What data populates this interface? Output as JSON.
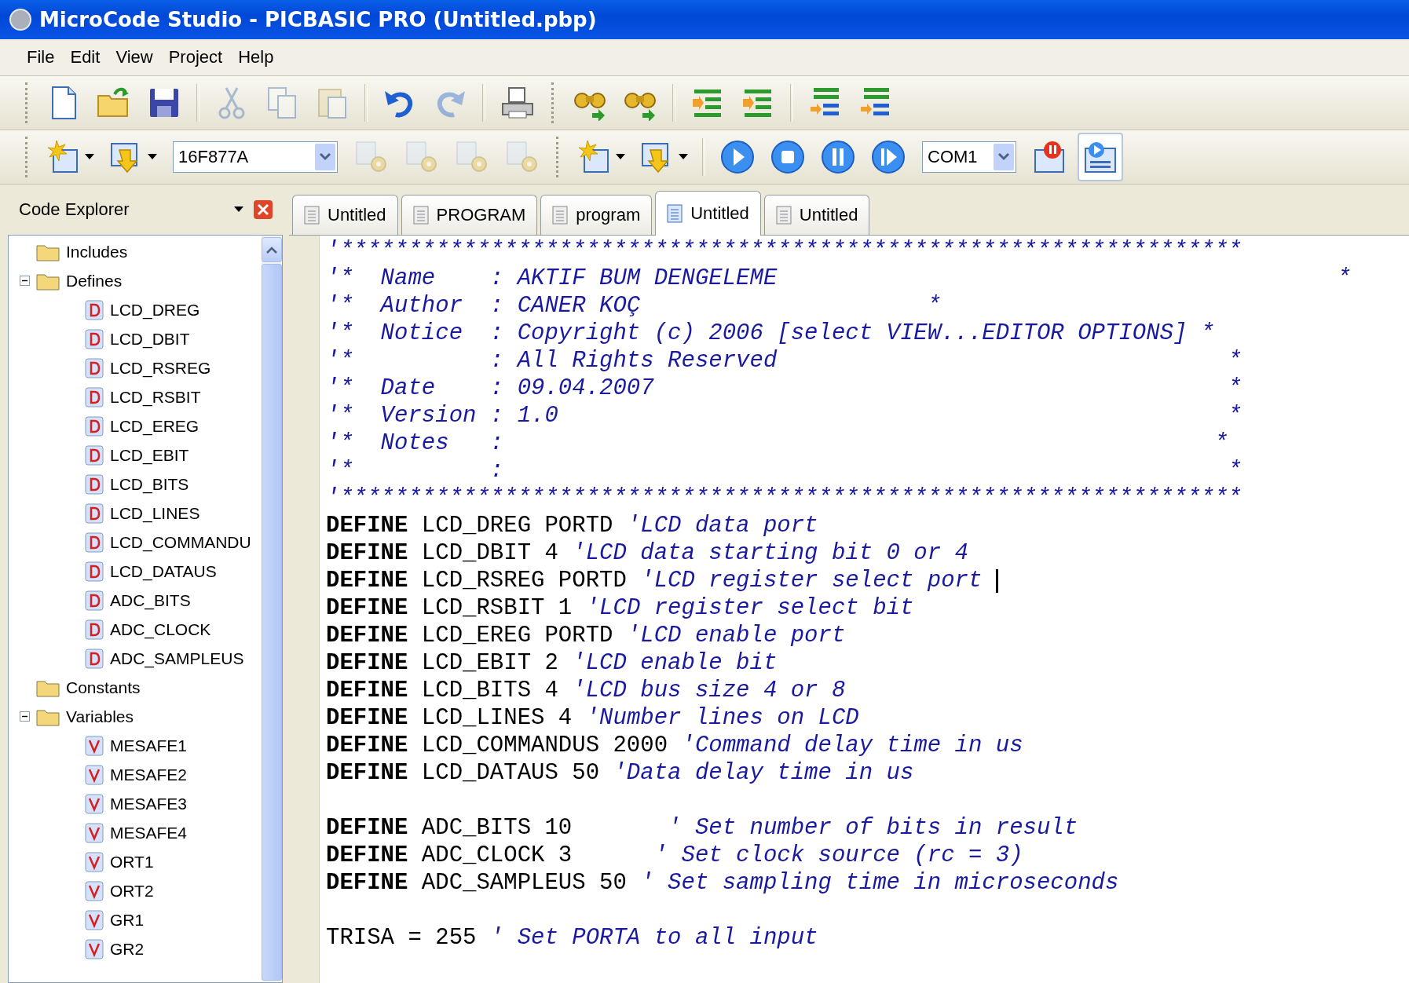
{
  "window": {
    "title": "MicroCode Studio - PICBASIC PRO (Untitled.pbp)"
  },
  "menu": [
    "File",
    "Edit",
    "View",
    "Project",
    "Help"
  ],
  "toolbar_main": [
    {
      "kind": "new",
      "disabled": false
    },
    {
      "kind": "open",
      "disabled": false
    },
    {
      "kind": "save",
      "disabled": false
    },
    {
      "kind": "separator"
    },
    {
      "kind": "cut",
      "disabled": true
    },
    {
      "kind": "copy",
      "disabled": true
    },
    {
      "kind": "paste",
      "disabled": true
    },
    {
      "kind": "separator"
    },
    {
      "kind": "undo",
      "disabled": false
    },
    {
      "kind": "redo",
      "disabled": true
    },
    {
      "kind": "separator"
    },
    {
      "kind": "print",
      "disabled": false
    },
    {
      "kind": "grip"
    },
    {
      "kind": "find",
      "disabled": false
    },
    {
      "kind": "replace",
      "disabled": false
    },
    {
      "kind": "separator"
    },
    {
      "kind": "indent",
      "disabled": false
    },
    {
      "kind": "outdent",
      "disabled": false
    },
    {
      "kind": "separator"
    },
    {
      "kind": "comment",
      "disabled": false
    },
    {
      "kind": "uncomment",
      "disabled": false
    }
  ],
  "toolbar_build": [
    {
      "kind": "new-project",
      "dropdown": true,
      "disabled": false
    },
    {
      "kind": "open-project",
      "dropdown": true,
      "disabled": false
    },
    {
      "kind": "combo",
      "value": "16F877A"
    },
    {
      "kind": "code-check",
      "disabled": true
    },
    {
      "kind": "compile",
      "disabled": true
    },
    {
      "kind": "stop-compile",
      "disabled": true
    },
    {
      "kind": "info",
      "disabled": true
    },
    {
      "kind": "grip"
    },
    {
      "kind": "new-window",
      "dropdown": true,
      "disabled": false
    },
    {
      "kind": "open-window",
      "dropdown": true,
      "disabled": false
    },
    {
      "kind": "separator"
    },
    {
      "kind": "run",
      "disabled": false
    },
    {
      "kind": "stop",
      "disabled": false
    },
    {
      "kind": "pause",
      "disabled": false
    },
    {
      "kind": "step",
      "disabled": false
    },
    {
      "kind": "combo",
      "value": "COM1"
    },
    {
      "kind": "monitor-pause",
      "disabled": false
    },
    {
      "kind": "loader",
      "disabled": false,
      "selected": true
    }
  ],
  "explorer": {
    "title": "Code Explorer",
    "tree": [
      {
        "label": "Includes",
        "kind": "folder"
      },
      {
        "label": "Defines",
        "kind": "folder",
        "expanded": true,
        "children": [
          {
            "label": "LCD_DREG",
            "kind": "define"
          },
          {
            "label": "LCD_DBIT",
            "kind": "define"
          },
          {
            "label": "LCD_RSREG",
            "kind": "define"
          },
          {
            "label": "LCD_RSBIT",
            "kind": "define"
          },
          {
            "label": "LCD_EREG",
            "kind": "define"
          },
          {
            "label": "LCD_EBIT",
            "kind": "define"
          },
          {
            "label": "LCD_BITS",
            "kind": "define"
          },
          {
            "label": "LCD_LINES",
            "kind": "define"
          },
          {
            "label": "LCD_COMMANDU",
            "kind": "define"
          },
          {
            "label": "LCD_DATAUS",
            "kind": "define"
          },
          {
            "label": "ADC_BITS",
            "kind": "define"
          },
          {
            "label": "ADC_CLOCK",
            "kind": "define"
          },
          {
            "label": "ADC_SAMPLEUS",
            "kind": "define"
          }
        ]
      },
      {
        "label": "Constants",
        "kind": "folder"
      },
      {
        "label": "Variables",
        "kind": "folder",
        "expanded": true,
        "children": [
          {
            "label": "MESAFE1",
            "kind": "variable"
          },
          {
            "label": "MESAFE2",
            "kind": "variable"
          },
          {
            "label": "MESAFE3",
            "kind": "variable"
          },
          {
            "label": "MESAFE4",
            "kind": "variable"
          },
          {
            "label": "ORT1",
            "kind": "variable"
          },
          {
            "label": "ORT2",
            "kind": "variable"
          },
          {
            "label": "GR1",
            "kind": "variable"
          },
          {
            "label": "GR2",
            "kind": "variable"
          }
        ]
      }
    ]
  },
  "tabs": [
    {
      "label": "Untitled",
      "selected": false
    },
    {
      "label": "PROGRAM",
      "selected": false
    },
    {
      "label": "program",
      "selected": false
    },
    {
      "label": "Untitled",
      "selected": true
    },
    {
      "label": "Untitled",
      "selected": false
    }
  ],
  "editor": {
    "blocks": [
      {
        "lines": [
          {
            "segments": [
              {
                "kind": "comment",
                "text": "'******************************************************************"
              }
            ]
          },
          {
            "segments": [
              {
                "kind": "comment",
                "text": "'*  Name    : AKTIF BUM DENGELEME                                         *"
              }
            ]
          },
          {
            "segments": [
              {
                "kind": "comment",
                "text": "'*  Author  : CANER KOÇ                     *"
              }
            ]
          },
          {
            "segments": [
              {
                "kind": "comment",
                "text": "'*  Notice  : Copyright (c) 2006 [select VIEW...EDITOR OPTIONS] *"
              }
            ]
          },
          {
            "segments": [
              {
                "kind": "comment",
                "text": "'*          : All Rights Reserved                                 *"
              }
            ]
          },
          {
            "segments": [
              {
                "kind": "comment",
                "text": "'*  Date    : 09.04.2007                                          *"
              }
            ]
          },
          {
            "segments": [
              {
                "kind": "comment",
                "text": "'*  Version : 1.0                                                 *"
              }
            ]
          },
          {
            "segments": [
              {
                "kind": "comment",
                "text": "'*  Notes   :                                                    *"
              }
            ]
          },
          {
            "segments": [
              {
                "kind": "comment",
                "text": "'*          :                                                     *"
              }
            ]
          },
          {
            "segments": [
              {
                "kind": "comment",
                "text": "'******************************************************************"
              }
            ]
          },
          {
            "segments": [
              {
                "kind": "keyword",
                "text": "DEFINE"
              },
              {
                "kind": "plain",
                "text": " LCD_DREG PORTD "
              },
              {
                "kind": "comment",
                "text": "'LCD data port"
              }
            ]
          },
          {
            "segments": [
              {
                "kind": "keyword",
                "text": "DEFINE"
              },
              {
                "kind": "plain",
                "text": " LCD_DBIT 4 "
              },
              {
                "kind": "comment",
                "text": "'LCD data starting bit 0 or 4"
              }
            ]
          },
          {
            "segments": [
              {
                "kind": "keyword",
                "text": "DEFINE"
              },
              {
                "kind": "plain",
                "text": " LCD_RSREG PORTD "
              },
              {
                "kind": "comment",
                "text": "'LCD register select port "
              }
            ],
            "caret": true
          },
          {
            "segments": [
              {
                "kind": "keyword",
                "text": "DEFINE"
              },
              {
                "kind": "plain",
                "text": " LCD_RSBIT 1 "
              },
              {
                "kind": "comment",
                "text": "'LCD register select bit"
              }
            ]
          },
          {
            "segments": [
              {
                "kind": "keyword",
                "text": "DEFINE"
              },
              {
                "kind": "plain",
                "text": " LCD_EREG PORTD "
              },
              {
                "kind": "comment",
                "text": "'LCD enable port"
              }
            ]
          },
          {
            "segments": [
              {
                "kind": "keyword",
                "text": "DEFINE"
              },
              {
                "kind": "plain",
                "text": " LCD_EBIT 2 "
              },
              {
                "kind": "comment",
                "text": "'LCD enable bit"
              }
            ]
          },
          {
            "segments": [
              {
                "kind": "keyword",
                "text": "DEFINE"
              },
              {
                "kind": "plain",
                "text": " LCD_BITS 4 "
              },
              {
                "kind": "comment",
                "text": "'LCD bus size 4 or 8"
              }
            ]
          },
          {
            "segments": [
              {
                "kind": "keyword",
                "text": "DEFINE"
              },
              {
                "kind": "plain",
                "text": " LCD_LINES 4 "
              },
              {
                "kind": "comment",
                "text": "'Number lines on LCD"
              }
            ]
          },
          {
            "segments": [
              {
                "kind": "keyword",
                "text": "DEFINE"
              },
              {
                "kind": "plain",
                "text": " LCD_COMMANDUS 2000 "
              },
              {
                "kind": "comment",
                "text": "'Command delay time in us"
              }
            ]
          },
          {
            "segments": [
              {
                "kind": "keyword",
                "text": "DEFINE"
              },
              {
                "kind": "plain",
                "text": " LCD_DATAUS 50 "
              },
              {
                "kind": "comment",
                "text": "'Data delay time in us"
              }
            ]
          }
        ]
      },
      {
        "lines": [
          {
            "segments": [
              {
                "kind": "keyword",
                "text": "DEFINE"
              },
              {
                "kind": "plain",
                "text": " ADC_BITS 10       "
              },
              {
                "kind": "comment",
                "text": "' Set number of bits in result"
              }
            ]
          },
          {
            "segments": [
              {
                "kind": "keyword",
                "text": "DEFINE"
              },
              {
                "kind": "plain",
                "text": " ADC_CLOCK 3      "
              },
              {
                "kind": "comment",
                "text": "' Set clock source (rc = 3)"
              }
            ]
          },
          {
            "segments": [
              {
                "kind": "keyword",
                "text": "DEFINE"
              },
              {
                "kind": "plain",
                "text": " ADC_SAMPLEUS 50 "
              },
              {
                "kind": "comment",
                "text": "' Set sampling time in microseconds"
              }
            ]
          }
        ]
      },
      {
        "lines": [
          {
            "segments": [
              {
                "kind": "plain",
                "text": "TRISA = 255 "
              },
              {
                "kind": "comment",
                "text": "' Set PORTA to all input"
              }
            ]
          }
        ]
      }
    ]
  }
}
